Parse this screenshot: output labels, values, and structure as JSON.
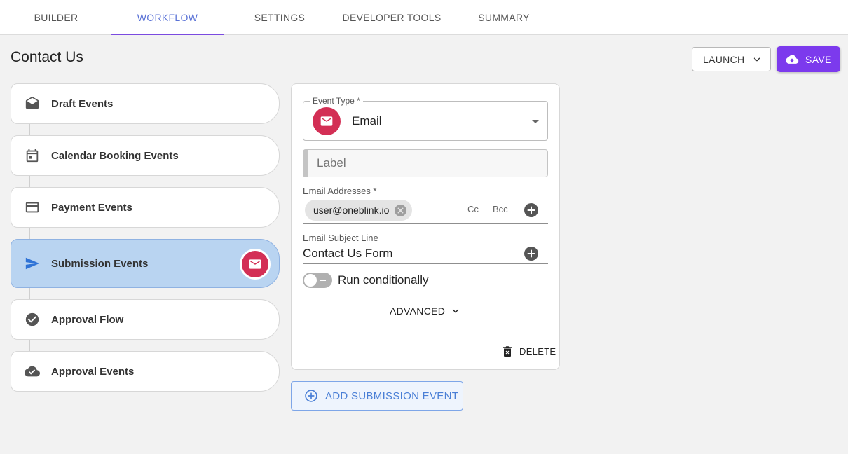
{
  "tabs": [
    {
      "label": "BUILDER",
      "active": false
    },
    {
      "label": "WORKFLOW",
      "active": true
    },
    {
      "label": "SETTINGS",
      "active": false
    },
    {
      "label": "DEVELOPER TOOLS",
      "active": false
    },
    {
      "label": "SUMMARY",
      "active": false
    }
  ],
  "page": {
    "title": "Contact Us"
  },
  "toolbar": {
    "launch_label": "LAUNCH",
    "save_label": "SAVE"
  },
  "events": [
    {
      "label": "Draft Events",
      "icon": "envelope-open-icon"
    },
    {
      "label": "Calendar Booking Events",
      "icon": "calendar-icon"
    },
    {
      "label": "Payment Events",
      "icon": "credit-card-icon"
    },
    {
      "label": "Submission Events",
      "icon": "send-icon",
      "selected": true
    },
    {
      "label": "Approval Flow",
      "icon": "check-circle-icon"
    },
    {
      "label": "Approval Events",
      "icon": "cloud-check-icon"
    }
  ],
  "panel": {
    "event_type_legend": "Event Type *",
    "event_type_value": "Email",
    "label_placeholder": "Label",
    "email_addresses_label": "Email Addresses *",
    "email_chip": "user@oneblink.io",
    "cc_label": "Cc",
    "bcc_label": "Bcc",
    "subject_label": "Email Subject Line",
    "subject_value": "Contact Us Form",
    "run_conditionally_label": "Run conditionally",
    "advanced_label": "ADVANCED",
    "delete_label": "DELETE"
  },
  "add_event_label": "ADD SUBMISSION EVENT",
  "colors": {
    "accent_purple": "#7c3aed",
    "active_tab_text": "#5a72d6",
    "email_red": "#d32f55",
    "selected_card": "#b9d4f1",
    "link_blue": "#4a7fd6"
  }
}
